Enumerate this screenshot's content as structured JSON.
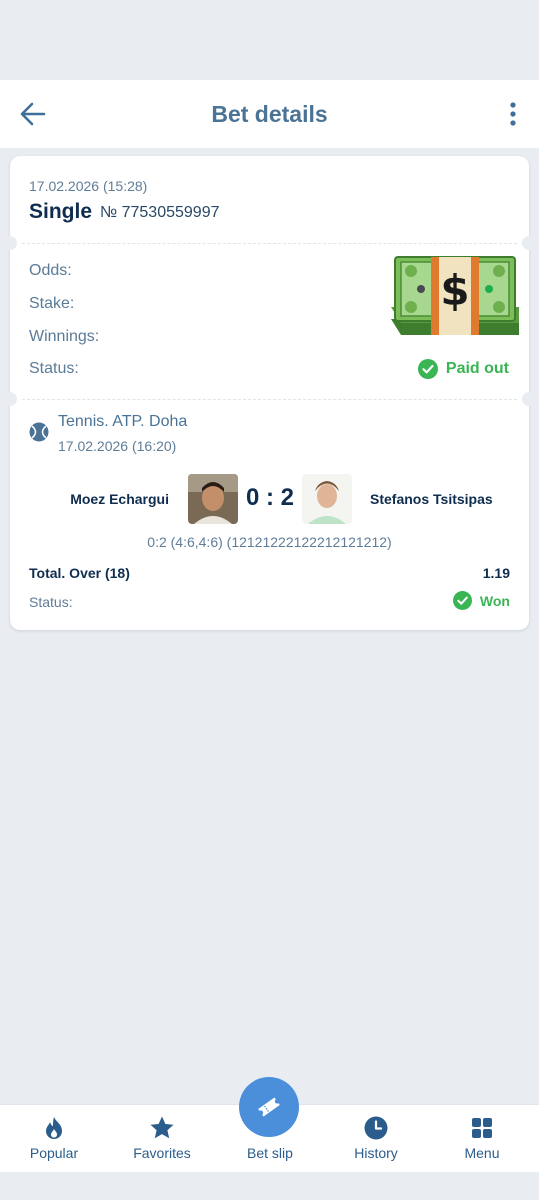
{
  "header": {
    "title": "Bet details"
  },
  "bet": {
    "date": "17.02.2026 (15:28)",
    "type": "Single",
    "number": "№ 77530559997"
  },
  "summary": {
    "odds_label": "Odds:",
    "stake_label": "Stake:",
    "winnings_label": "Winnings:",
    "status_label": "Status:",
    "status_value": "Paid out"
  },
  "event": {
    "league": "Tennis. ATP. Doha",
    "date": "17.02.2026 (16:20)",
    "player1": "Moez Echargui",
    "player2": "Stefanos Tsitsipas",
    "score": "0 : 2",
    "score_detail": "0:2 (4:6,4:6) (12121222122212121212)"
  },
  "selection": {
    "market": "Total. Over (18)",
    "odds": "1.19",
    "status_label": "Status:",
    "status_value": "Won"
  },
  "nav": {
    "popular": "Popular",
    "favorites": "Favorites",
    "bet_slip": "Bet slip",
    "history": "History",
    "menu": "Menu"
  },
  "colors": {
    "accent": "#4a7396",
    "success": "#3ab554",
    "fab": "#4b8fdb",
    "background": "#e9edf2"
  },
  "icons": [
    "back-arrow-icon",
    "more-vertical-icon",
    "money-stack-icon",
    "check-circle-icon",
    "tennis-ball-icon",
    "flame-icon",
    "star-icon",
    "ticket-icon",
    "clock-icon",
    "grid-icon"
  ]
}
